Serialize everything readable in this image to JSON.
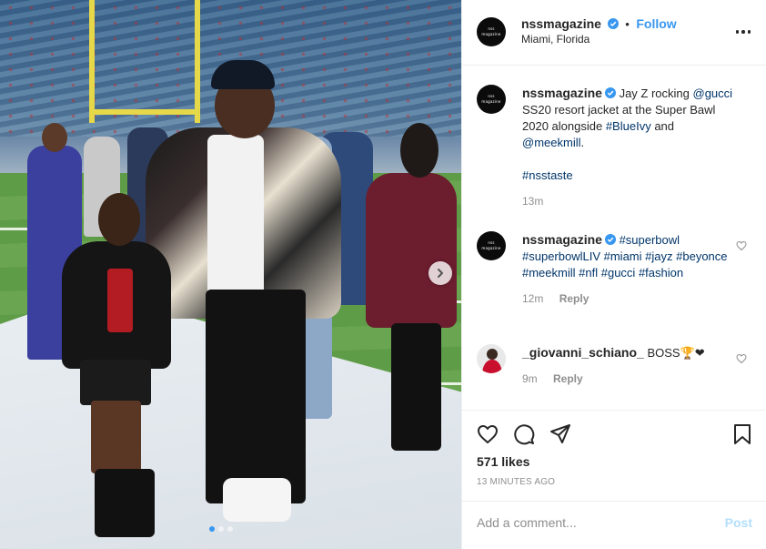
{
  "photo": {
    "slide_count": 3,
    "active_slide": 1,
    "next_icon": "chevron-right-icon",
    "description": ""
  },
  "header": {
    "username": "nssmagazine",
    "follow_separator": "•",
    "follow_label": "Follow",
    "location": "Miami, Florida",
    "avatar_text": "nss",
    "avatar_subtext": "magazine"
  },
  "caption": {
    "username": "nssmagazine",
    "text_1": "Jay Z rocking",
    "mention_gucci": "@gucci",
    "text_2": "SS20 resort jacket at the Super Bawl 2020 alongside",
    "hashtag_blueivy": "#BlueIvy",
    "text_3": "and",
    "mention_meekmill": "@meekmill",
    "text_4": ".",
    "hashtag_nsstaste": "#nsstaste",
    "time": "13m"
  },
  "comments": [
    {
      "username": "nssmagazine",
      "tags": [
        "#superbowl",
        "#superbowlLIV",
        "#miami",
        "#jayz",
        "#beyonce",
        "#meekmill",
        "#nfl",
        "#gucci",
        "#fashion"
      ],
      "time": "12m",
      "reply_label": "Reply"
    },
    {
      "username": "_giovanni_schiano_",
      "text": "BOSS🏆❤",
      "time": "9m",
      "reply_label": "Reply"
    }
  ],
  "actions": {
    "likes": "571 likes",
    "time_ago": "13 MINUTES AGO"
  },
  "add_comment": {
    "placeholder": "Add a comment...",
    "value": "",
    "post_label": "Post"
  },
  "colors": {
    "link": "#003569",
    "follow": "#3897f0",
    "muted": "#8e8e8e",
    "post_disabled": "#b2dffc",
    "verified": "#3897f0"
  }
}
